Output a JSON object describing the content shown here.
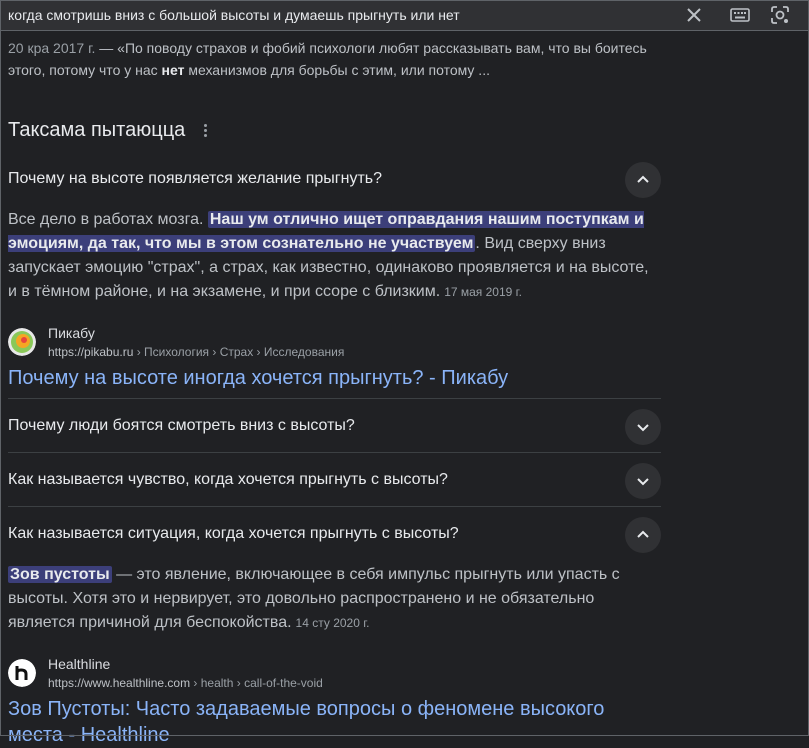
{
  "search": {
    "query": "когда смотришь вниз с большой высоты и думаешь прыгнуть или нет"
  },
  "top_snippet": {
    "date": "20 кра 2017 г.",
    "dash": " — ",
    "text_before": "«По поводу страхов и фобий психологи любят рассказывать вам, что вы боитесь этого, потому что у нас ",
    "bold": "нет",
    "text_after": " механизмов для борьбы с этим, или потому ..."
  },
  "paa": {
    "title": "Таксама пытаюцца",
    "questions": [
      {
        "question": "Почему на высоте появляется желание прыгнуть?",
        "expanded": true,
        "answer_prefix": "Все дело в работах мозга. ",
        "answer_highlight": "Наш ум отлично ищет оправдания нашим поступкам и эмоциям, да так, что мы в этом сознательно не участвуем",
        "answer_suffix": ". Вид сверху вниз запускает эмоцию \"страх\", а страх, как известно, одинаково проявляется и на высоте, и в тёмном районе, и на экзамене, и при ссоре с близким.",
        "answer_date": "17 мая 2019 г.",
        "source_name": "Пикабу",
        "source_url_base": "https://pikabu.ru",
        "source_url_path": " › Психология › Страх › Исследования",
        "link_title": "Почему на высоте иногда хочется прыгнуть? - Пикабу"
      },
      {
        "question": "Почему люди боятся смотреть вниз с высоты?",
        "expanded": false
      },
      {
        "question": "Как называется чувство, когда хочется прыгнуть с высоты?",
        "expanded": false
      },
      {
        "question": "Как называется ситуация, когда хочется прыгнуть с высоты?",
        "expanded": true,
        "answer_prefix": "",
        "answer_highlight": "Зов пустоты",
        "answer_suffix": " — это явление, включающее в себя импульс прыгнуть или упасть с высоты. Хотя это и нервирует, это довольно распространено и не обязательно является причиной для беспокойства.",
        "answer_date": "14 сту 2020 г.",
        "source_name": "Healthline",
        "source_url_base": "https://www.healthline.com",
        "source_url_path": " › health › call-of-the-void",
        "link_title": "Зов Пустоты: Часто задаваемые вопросы о феномене высокого места - Healthline"
      }
    ]
  },
  "colors": {
    "background": "#202124",
    "link": "#8ab4f8",
    "highlight": "#3c3f7a"
  }
}
